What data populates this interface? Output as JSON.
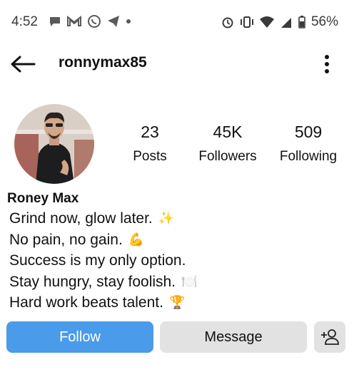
{
  "status_bar": {
    "time": "4:52",
    "battery": "56%"
  },
  "header": {
    "username": "ronnymax85"
  },
  "profile": {
    "stats": [
      {
        "value": "23",
        "label": "Posts"
      },
      {
        "value": "45K",
        "label": "Followers"
      },
      {
        "value": "509",
        "label": "Following"
      }
    ],
    "name": "Roney Max",
    "bio": [
      {
        "text": "Grind now, glow later.",
        "emoji": "✨"
      },
      {
        "text": "No pain, no gain.",
        "emoji": "💪"
      },
      {
        "text": "Success is my only option.",
        "emoji": ""
      },
      {
        "text": "Stay hungry, stay foolish.",
        "emoji": "🍽️"
      },
      {
        "text": "Hard work beats talent.",
        "emoji": "🏆"
      }
    ]
  },
  "actions": {
    "follow_label": "Follow",
    "message_label": "Message"
  },
  "colors": {
    "follow_button": "#4a9bea",
    "secondary_button": "#e2e2e2"
  }
}
